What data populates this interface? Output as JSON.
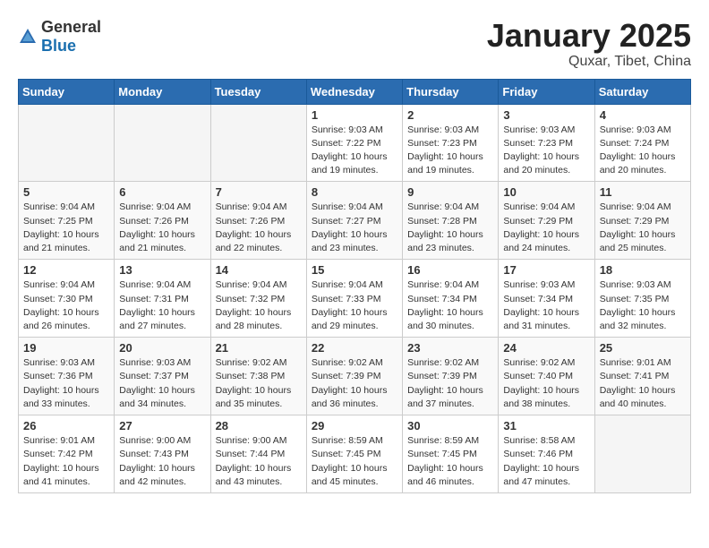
{
  "logo": {
    "general": "General",
    "blue": "Blue"
  },
  "title": "January 2025",
  "subtitle": "Quxar, Tibet, China",
  "days_of_week": [
    "Sunday",
    "Monday",
    "Tuesday",
    "Wednesday",
    "Thursday",
    "Friday",
    "Saturday"
  ],
  "weeks": [
    [
      {
        "day": "",
        "info": ""
      },
      {
        "day": "",
        "info": ""
      },
      {
        "day": "",
        "info": ""
      },
      {
        "day": "1",
        "info": "Sunrise: 9:03 AM\nSunset: 7:22 PM\nDaylight: 10 hours and 19 minutes."
      },
      {
        "day": "2",
        "info": "Sunrise: 9:03 AM\nSunset: 7:23 PM\nDaylight: 10 hours and 19 minutes."
      },
      {
        "day": "3",
        "info": "Sunrise: 9:03 AM\nSunset: 7:23 PM\nDaylight: 10 hours and 20 minutes."
      },
      {
        "day": "4",
        "info": "Sunrise: 9:03 AM\nSunset: 7:24 PM\nDaylight: 10 hours and 20 minutes."
      }
    ],
    [
      {
        "day": "5",
        "info": "Sunrise: 9:04 AM\nSunset: 7:25 PM\nDaylight: 10 hours and 21 minutes."
      },
      {
        "day": "6",
        "info": "Sunrise: 9:04 AM\nSunset: 7:26 PM\nDaylight: 10 hours and 21 minutes."
      },
      {
        "day": "7",
        "info": "Sunrise: 9:04 AM\nSunset: 7:26 PM\nDaylight: 10 hours and 22 minutes."
      },
      {
        "day": "8",
        "info": "Sunrise: 9:04 AM\nSunset: 7:27 PM\nDaylight: 10 hours and 23 minutes."
      },
      {
        "day": "9",
        "info": "Sunrise: 9:04 AM\nSunset: 7:28 PM\nDaylight: 10 hours and 23 minutes."
      },
      {
        "day": "10",
        "info": "Sunrise: 9:04 AM\nSunset: 7:29 PM\nDaylight: 10 hours and 24 minutes."
      },
      {
        "day": "11",
        "info": "Sunrise: 9:04 AM\nSunset: 7:29 PM\nDaylight: 10 hours and 25 minutes."
      }
    ],
    [
      {
        "day": "12",
        "info": "Sunrise: 9:04 AM\nSunset: 7:30 PM\nDaylight: 10 hours and 26 minutes."
      },
      {
        "day": "13",
        "info": "Sunrise: 9:04 AM\nSunset: 7:31 PM\nDaylight: 10 hours and 27 minutes."
      },
      {
        "day": "14",
        "info": "Sunrise: 9:04 AM\nSunset: 7:32 PM\nDaylight: 10 hours and 28 minutes."
      },
      {
        "day": "15",
        "info": "Sunrise: 9:04 AM\nSunset: 7:33 PM\nDaylight: 10 hours and 29 minutes."
      },
      {
        "day": "16",
        "info": "Sunrise: 9:04 AM\nSunset: 7:34 PM\nDaylight: 10 hours and 30 minutes."
      },
      {
        "day": "17",
        "info": "Sunrise: 9:03 AM\nSunset: 7:34 PM\nDaylight: 10 hours and 31 minutes."
      },
      {
        "day": "18",
        "info": "Sunrise: 9:03 AM\nSunset: 7:35 PM\nDaylight: 10 hours and 32 minutes."
      }
    ],
    [
      {
        "day": "19",
        "info": "Sunrise: 9:03 AM\nSunset: 7:36 PM\nDaylight: 10 hours and 33 minutes."
      },
      {
        "day": "20",
        "info": "Sunrise: 9:03 AM\nSunset: 7:37 PM\nDaylight: 10 hours and 34 minutes."
      },
      {
        "day": "21",
        "info": "Sunrise: 9:02 AM\nSunset: 7:38 PM\nDaylight: 10 hours and 35 minutes."
      },
      {
        "day": "22",
        "info": "Sunrise: 9:02 AM\nSunset: 7:39 PM\nDaylight: 10 hours and 36 minutes."
      },
      {
        "day": "23",
        "info": "Sunrise: 9:02 AM\nSunset: 7:39 PM\nDaylight: 10 hours and 37 minutes."
      },
      {
        "day": "24",
        "info": "Sunrise: 9:02 AM\nSunset: 7:40 PM\nDaylight: 10 hours and 38 minutes."
      },
      {
        "day": "25",
        "info": "Sunrise: 9:01 AM\nSunset: 7:41 PM\nDaylight: 10 hours and 40 minutes."
      }
    ],
    [
      {
        "day": "26",
        "info": "Sunrise: 9:01 AM\nSunset: 7:42 PM\nDaylight: 10 hours and 41 minutes."
      },
      {
        "day": "27",
        "info": "Sunrise: 9:00 AM\nSunset: 7:43 PM\nDaylight: 10 hours and 42 minutes."
      },
      {
        "day": "28",
        "info": "Sunrise: 9:00 AM\nSunset: 7:44 PM\nDaylight: 10 hours and 43 minutes."
      },
      {
        "day": "29",
        "info": "Sunrise: 8:59 AM\nSunset: 7:45 PM\nDaylight: 10 hours and 45 minutes."
      },
      {
        "day": "30",
        "info": "Sunrise: 8:59 AM\nSunset: 7:45 PM\nDaylight: 10 hours and 46 minutes."
      },
      {
        "day": "31",
        "info": "Sunrise: 8:58 AM\nSunset: 7:46 PM\nDaylight: 10 hours and 47 minutes."
      },
      {
        "day": "",
        "info": ""
      }
    ]
  ]
}
